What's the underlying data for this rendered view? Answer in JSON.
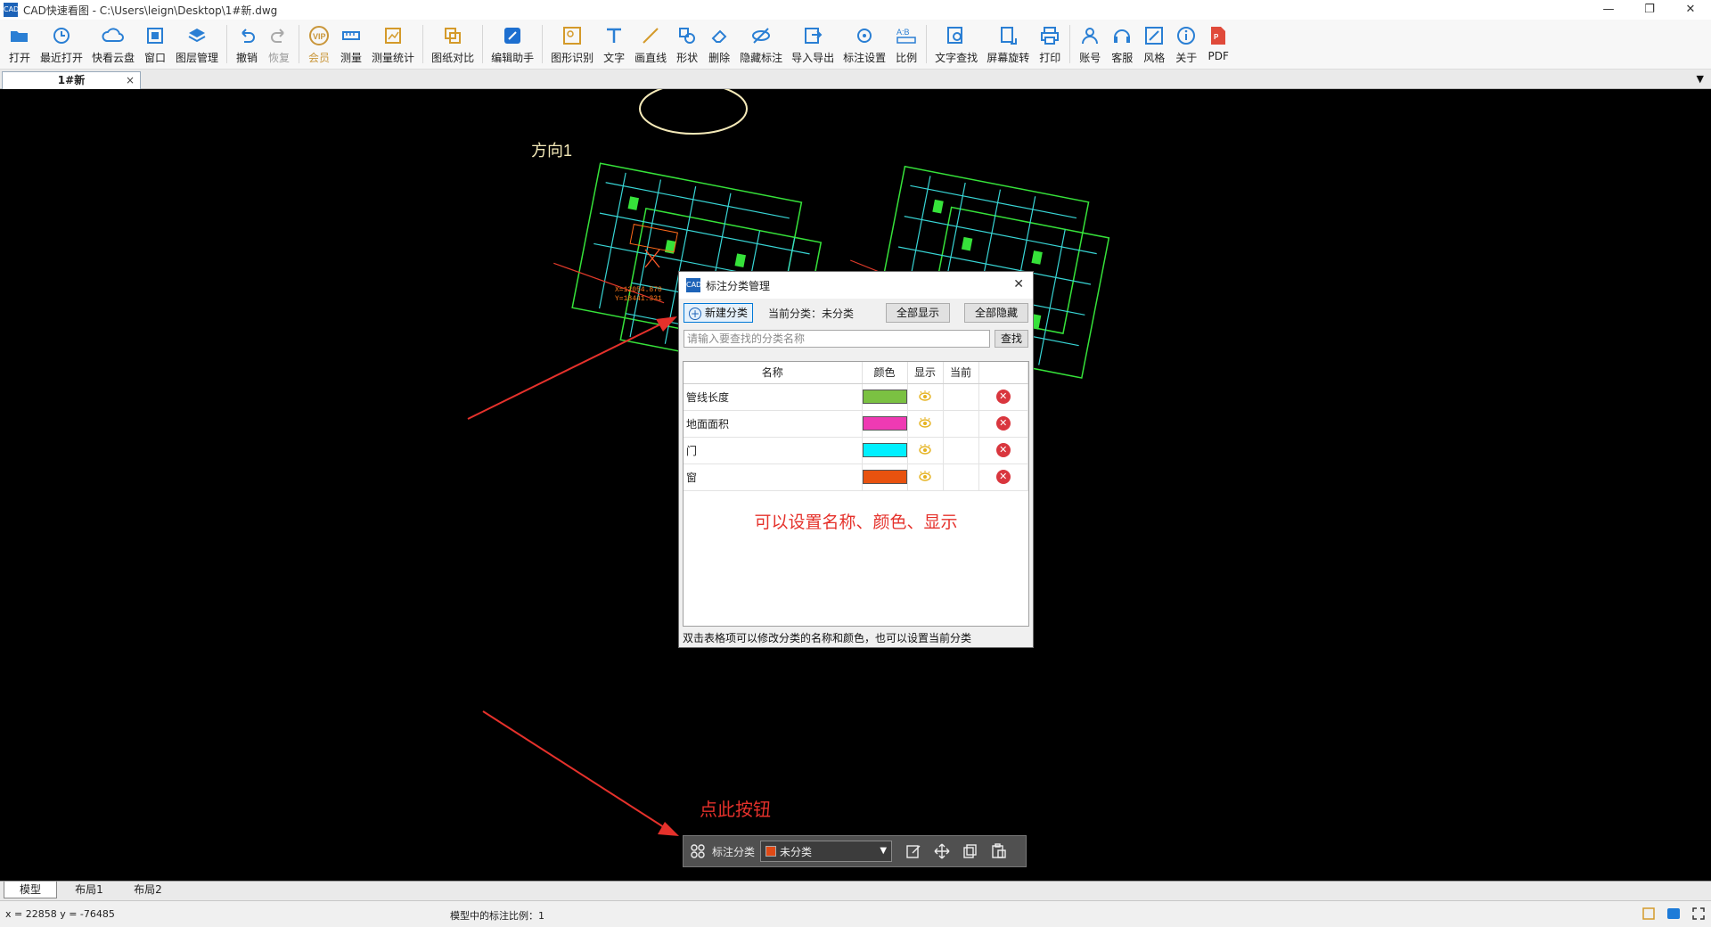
{
  "window": {
    "title": "CAD快速看图 - C:\\Users\\leign\\Desktop\\1#新.dwg",
    "app_icon_text": "CAD",
    "min": "—",
    "restore": "❐",
    "close": "✕"
  },
  "toolbar": [
    {
      "label": "打开",
      "icon": "folder-open-icon"
    },
    {
      "label": "最近打开",
      "icon": "history-icon"
    },
    {
      "label": "快看云盘",
      "icon": "cloud-icon"
    },
    {
      "label": "窗口",
      "icon": "window-icon"
    },
    {
      "label": "图层管理",
      "icon": "layers-icon"
    },
    {
      "label": "撤销",
      "icon": "undo-icon"
    },
    {
      "label": "恢复",
      "icon": "redo-icon",
      "disabled": true
    },
    {
      "label": "会员",
      "icon": "vip-icon",
      "vip": true
    },
    {
      "label": "测量",
      "icon": "measure-icon"
    },
    {
      "label": "测量统计",
      "icon": "measure-stats-icon"
    },
    {
      "label": "图纸对比",
      "icon": "compare-icon"
    },
    {
      "label": "编辑助手",
      "icon": "edit-assistant-icon"
    },
    {
      "label": "图形识别",
      "icon": "shape-recognize-icon"
    },
    {
      "label": "文字",
      "icon": "text-icon"
    },
    {
      "label": "画直线",
      "icon": "line-icon"
    },
    {
      "label": "形状",
      "icon": "shape-icon"
    },
    {
      "label": "删除",
      "icon": "eraser-icon"
    },
    {
      "label": "隐藏标注",
      "icon": "hide-annotation-icon"
    },
    {
      "label": "导入导出",
      "icon": "import-export-icon"
    },
    {
      "label": "标注设置",
      "icon": "annotation-settings-icon"
    },
    {
      "label": "比例",
      "icon": "scale-icon"
    },
    {
      "label": "文字查找",
      "icon": "text-search-icon"
    },
    {
      "label": "屏幕旋转",
      "icon": "rotate-screen-icon"
    },
    {
      "label": "打印",
      "icon": "print-icon"
    },
    {
      "label": "账号",
      "icon": "account-icon"
    },
    {
      "label": "客服",
      "icon": "headset-icon"
    },
    {
      "label": "风格",
      "icon": "style-icon"
    },
    {
      "label": "关于",
      "icon": "info-icon"
    },
    {
      "label": "PDF",
      "icon": "pdf-icon"
    }
  ],
  "doc_tab": {
    "label": "1#新",
    "close": "×",
    "dropdown": "▼"
  },
  "drawing": {
    "direction_label": "方向1",
    "coord_label_x": "X=12054.870",
    "coord_label_y": "Y=18441.331"
  },
  "dialog": {
    "title": "标注分类管理",
    "close": "✕",
    "new_category_button": "新建分类",
    "new_category_plus": "+",
    "current_category_label": "当前分类：",
    "current_category_value": "未分类",
    "show_all_button": "全部显示",
    "hide_all_button": "全部隐藏",
    "search_placeholder": "请输入要查找的分类名称",
    "search_button": "查找",
    "columns": [
      "名称",
      "颜色",
      "显示",
      "当前",
      ""
    ],
    "rows": [
      {
        "name": "管线长度",
        "color": "#7bc142"
      },
      {
        "name": "地面面积",
        "color": "#ef3ab3"
      },
      {
        "name": "门",
        "color": "#00f0ff"
      },
      {
        "name": "窗",
        "color": "#e8520f"
      }
    ],
    "delete_glyph": "✕",
    "note": "可以设置名称、颜色、显示",
    "status": "双击表格项可以修改分类的名称和颜色，也可以设置当前分类"
  },
  "callout": {
    "text": "点此按钮"
  },
  "float_bar": {
    "label": "标注分类",
    "combo_value": "未分类",
    "combo_color": "#e04a16",
    "arrow": "▼"
  },
  "layout_tabs": [
    "模型",
    "布局1",
    "布局2"
  ],
  "statusbar": {
    "coords": "x = 22858  y = -76485",
    "scale": "模型中的标注比例：1"
  },
  "colors": {
    "accent": "#0078d7",
    "annotation_red": "#e5312b",
    "cad_green": "#36e23a",
    "cad_cyan": "#38d5d5"
  }
}
